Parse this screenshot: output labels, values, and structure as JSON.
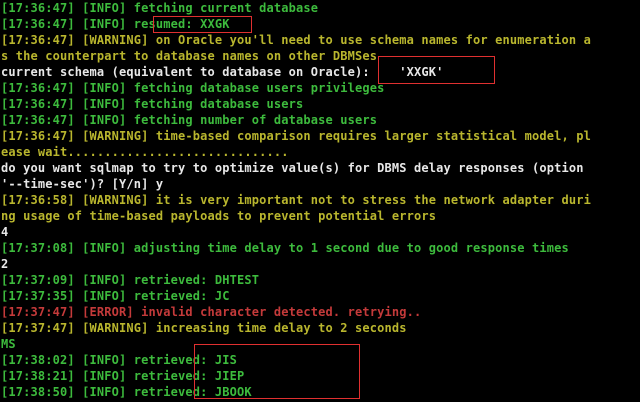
{
  "terminal": {
    "lines": [
      {
        "text": "[17:36:47] [INFO] fetching current database",
        "kind": "info"
      },
      {
        "text": "[17:36:47] [INFO] resumed: XXGK",
        "kind": "info"
      },
      {
        "text": "[17:36:47] [WARNING] on Oracle you'll need to use schema names for enumeration a",
        "kind": "warning"
      },
      {
        "text": "s the counterpart to database names on other DBMSes",
        "kind": "warning"
      },
      {
        "text": "current schema (equivalent to database on Oracle):    'XXGK'",
        "kind": "white"
      },
      {
        "text": "[17:36:47] [INFO] fetching database users privileges",
        "kind": "info"
      },
      {
        "text": "[17:36:47] [INFO] fetching database users",
        "kind": "info"
      },
      {
        "text": "[17:36:47] [INFO] fetching number of database users",
        "kind": "info"
      },
      {
        "text": "[17:36:47] [WARNING] time-based comparison requires larger statistical model, pl",
        "kind": "warning"
      },
      {
        "text": "ease wait..............................",
        "kind": "warning"
      },
      {
        "text": "do you want sqlmap to try to optimize value(s) for DBMS delay responses (option",
        "kind": "white"
      },
      {
        "text": "'--time-sec')? [Y/n] y",
        "kind": "white"
      },
      {
        "text": "[17:36:58] [WARNING] it is very important not to stress the network adapter duri",
        "kind": "warning"
      },
      {
        "text": "ng usage of time-based payloads to prevent potential errors",
        "kind": "warning"
      },
      {
        "text": "4",
        "kind": "white"
      },
      {
        "text": "[17:37:08] [INFO] adjusting time delay to 1 second due to good response times",
        "kind": "info"
      },
      {
        "text": "2",
        "kind": "white"
      },
      {
        "text": "[17:37:09] [INFO] retrieved: DHTEST",
        "kind": "info"
      },
      {
        "text": "[17:37:35] [INFO] retrieved: JC",
        "kind": "info"
      },
      {
        "text": "[17:37:47] [ERROR] invalid character detected. retrying..",
        "kind": "error"
      },
      {
        "text": "[17:37:47] [WARNING] increasing time delay to 2 seconds",
        "kind": "warning"
      },
      {
        "text": "MS",
        "kind": "green"
      },
      {
        "text": "[17:38:02] [INFO] retrieved: JIS",
        "kind": "info"
      },
      {
        "text": "[17:38:21] [INFO] retrieved: JIEP",
        "kind": "info"
      },
      {
        "text": "[17:38:50] [INFO] retrieved: JBOOK",
        "kind": "info"
      }
    ]
  },
  "colors": {
    "background": "#000000",
    "info": "#3dbb3d",
    "warning": "#b9b62e",
    "error": "#c43a3a",
    "white": "#e8e8e8",
    "highlight_box": "#e03030"
  }
}
